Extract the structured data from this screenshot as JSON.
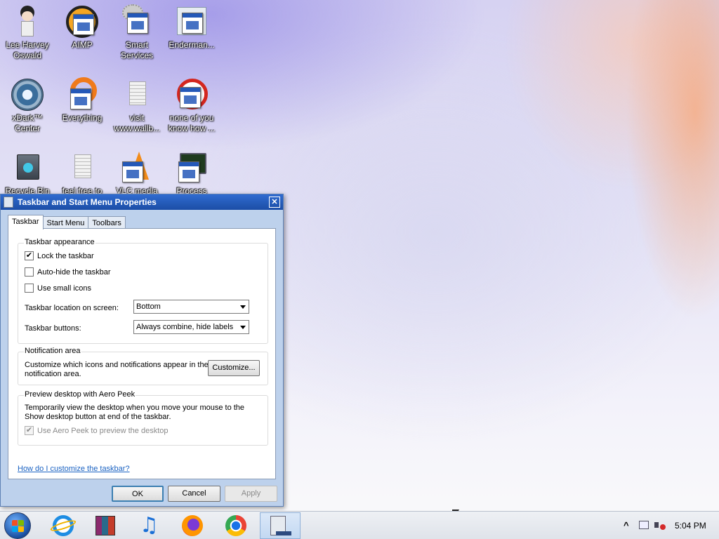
{
  "desktop": {
    "icons": [
      {
        "label": "Lee Harvey\nOswald"
      },
      {
        "label": "AIMP"
      },
      {
        "label": "Smart\nServices"
      },
      {
        "label": "Enderman..."
      },
      {
        "label": "xDark™\nCenter"
      },
      {
        "label": "Everything"
      },
      {
        "label": "visit\nwww.wallb..."
      },
      {
        "label": "none of you\nknow how ..."
      },
      {
        "label": "Recycle Bin"
      },
      {
        "label": "feel free to"
      },
      {
        "label": "VLC media"
      },
      {
        "label": "Process"
      }
    ]
  },
  "dialog": {
    "title": "Taskbar and Start Menu Properties",
    "close_glyph": "✕",
    "tabs": [
      {
        "label": "Taskbar",
        "active": true
      },
      {
        "label": "Start Menu",
        "active": false
      },
      {
        "label": "Toolbars",
        "active": false
      }
    ],
    "appearance": {
      "title": "Taskbar appearance",
      "lock": {
        "label": "Lock the taskbar",
        "checked": true
      },
      "autohide": {
        "label": "Auto-hide the taskbar",
        "checked": false
      },
      "small_icons": {
        "label": "Use small icons",
        "checked": false
      },
      "location_label": "Taskbar location on screen:",
      "location_value": "Bottom",
      "buttons_label": "Taskbar buttons:",
      "buttons_value": "Always combine, hide labels"
    },
    "notification": {
      "title": "Notification area",
      "text": "Customize which icons and notifications appear in the notification area.",
      "customize_label": "Customize..."
    },
    "aero_peek": {
      "title": "Preview desktop with Aero Peek",
      "text": "Temporarily view the desktop when you move your mouse to the Show desktop button at end of the taskbar.",
      "checkbox_label": "Use Aero Peek to preview the desktop",
      "checked": true,
      "disabled": true
    },
    "help_link": "How do I customize the taskbar?",
    "buttons": {
      "ok": "OK",
      "cancel": "Cancel",
      "apply": "Apply"
    }
  },
  "taskbar": {
    "apps": [
      "internet-explorer",
      "winrar",
      "itunes",
      "firefox",
      "chrome",
      "taskbar-properties"
    ],
    "tray": {
      "chevron": "^",
      "clock": "5:04 PM"
    }
  }
}
